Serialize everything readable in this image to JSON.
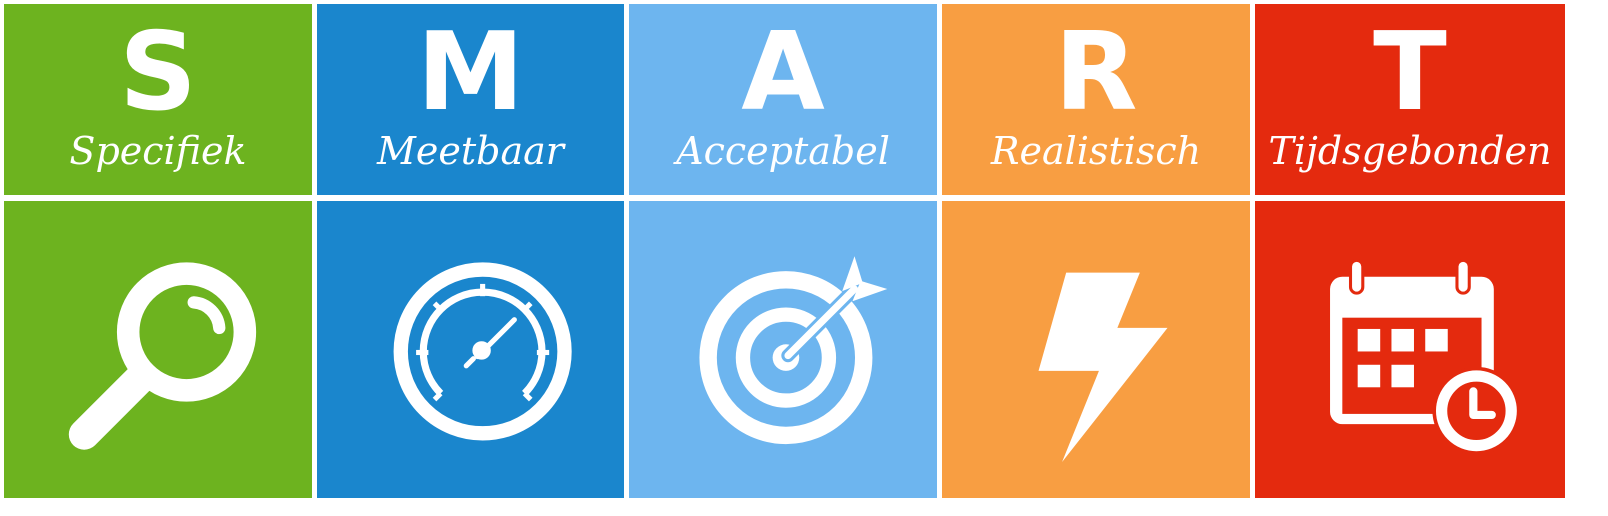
{
  "columns": [
    {
      "letter": "S",
      "word": "Specifiek",
      "color": "#6db31f",
      "icon": "magnifying-glass-icon"
    },
    {
      "letter": "M",
      "word": "Meetbaar",
      "color": "#1a86cd",
      "icon": "speedometer-icon"
    },
    {
      "letter": "A",
      "word": "Acceptabel",
      "color": "#6db5ef",
      "icon": "target-arrow-icon"
    },
    {
      "letter": "R",
      "word": "Realistisch",
      "color": "#f89e42",
      "icon": "lightning-bolt-icon"
    },
    {
      "letter": "T",
      "word": "Tijdsgebonden",
      "color": "#e42a0e",
      "icon": "calendar-clock-icon"
    }
  ]
}
